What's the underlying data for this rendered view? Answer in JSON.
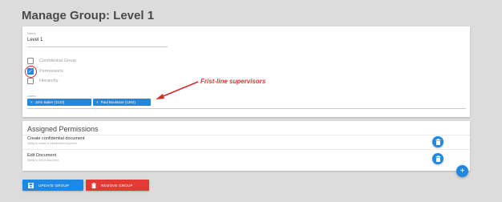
{
  "page": {
    "title": "Manage Group: Level 1"
  },
  "group_form": {
    "name_label": "Name",
    "name_value": "Level 1",
    "checkboxes": [
      {
        "label": "Confidential Group",
        "checked": false
      },
      {
        "label": "Permissions",
        "checked": true
      },
      {
        "label": "Hierarchy",
        "checked": false
      }
    ],
    "users_label": "Users",
    "users": [
      {
        "remove_glyph": "×",
        "label": "John Baker (1133)"
      },
      {
        "remove_glyph": "×",
        "label": "Paul Boulware (1264)"
      }
    ]
  },
  "annotation": {
    "text": "Frist-line supervisors",
    "color": "#e03030"
  },
  "permissions": {
    "title": "Assigned Permissions",
    "items": [
      {
        "name": "Create confidential document",
        "description": "Ability to create a confidential document"
      },
      {
        "name": "Edit Document",
        "description": "Ability to edit a document"
      }
    ]
  },
  "actions": {
    "update_label": "UPDATE GROUP",
    "remove_label": "REMOVE GROUP",
    "add_glyph": "+"
  },
  "colors": {
    "primary": "#1e88e5",
    "danger": "#e53935",
    "background": "#dcdcdc"
  }
}
